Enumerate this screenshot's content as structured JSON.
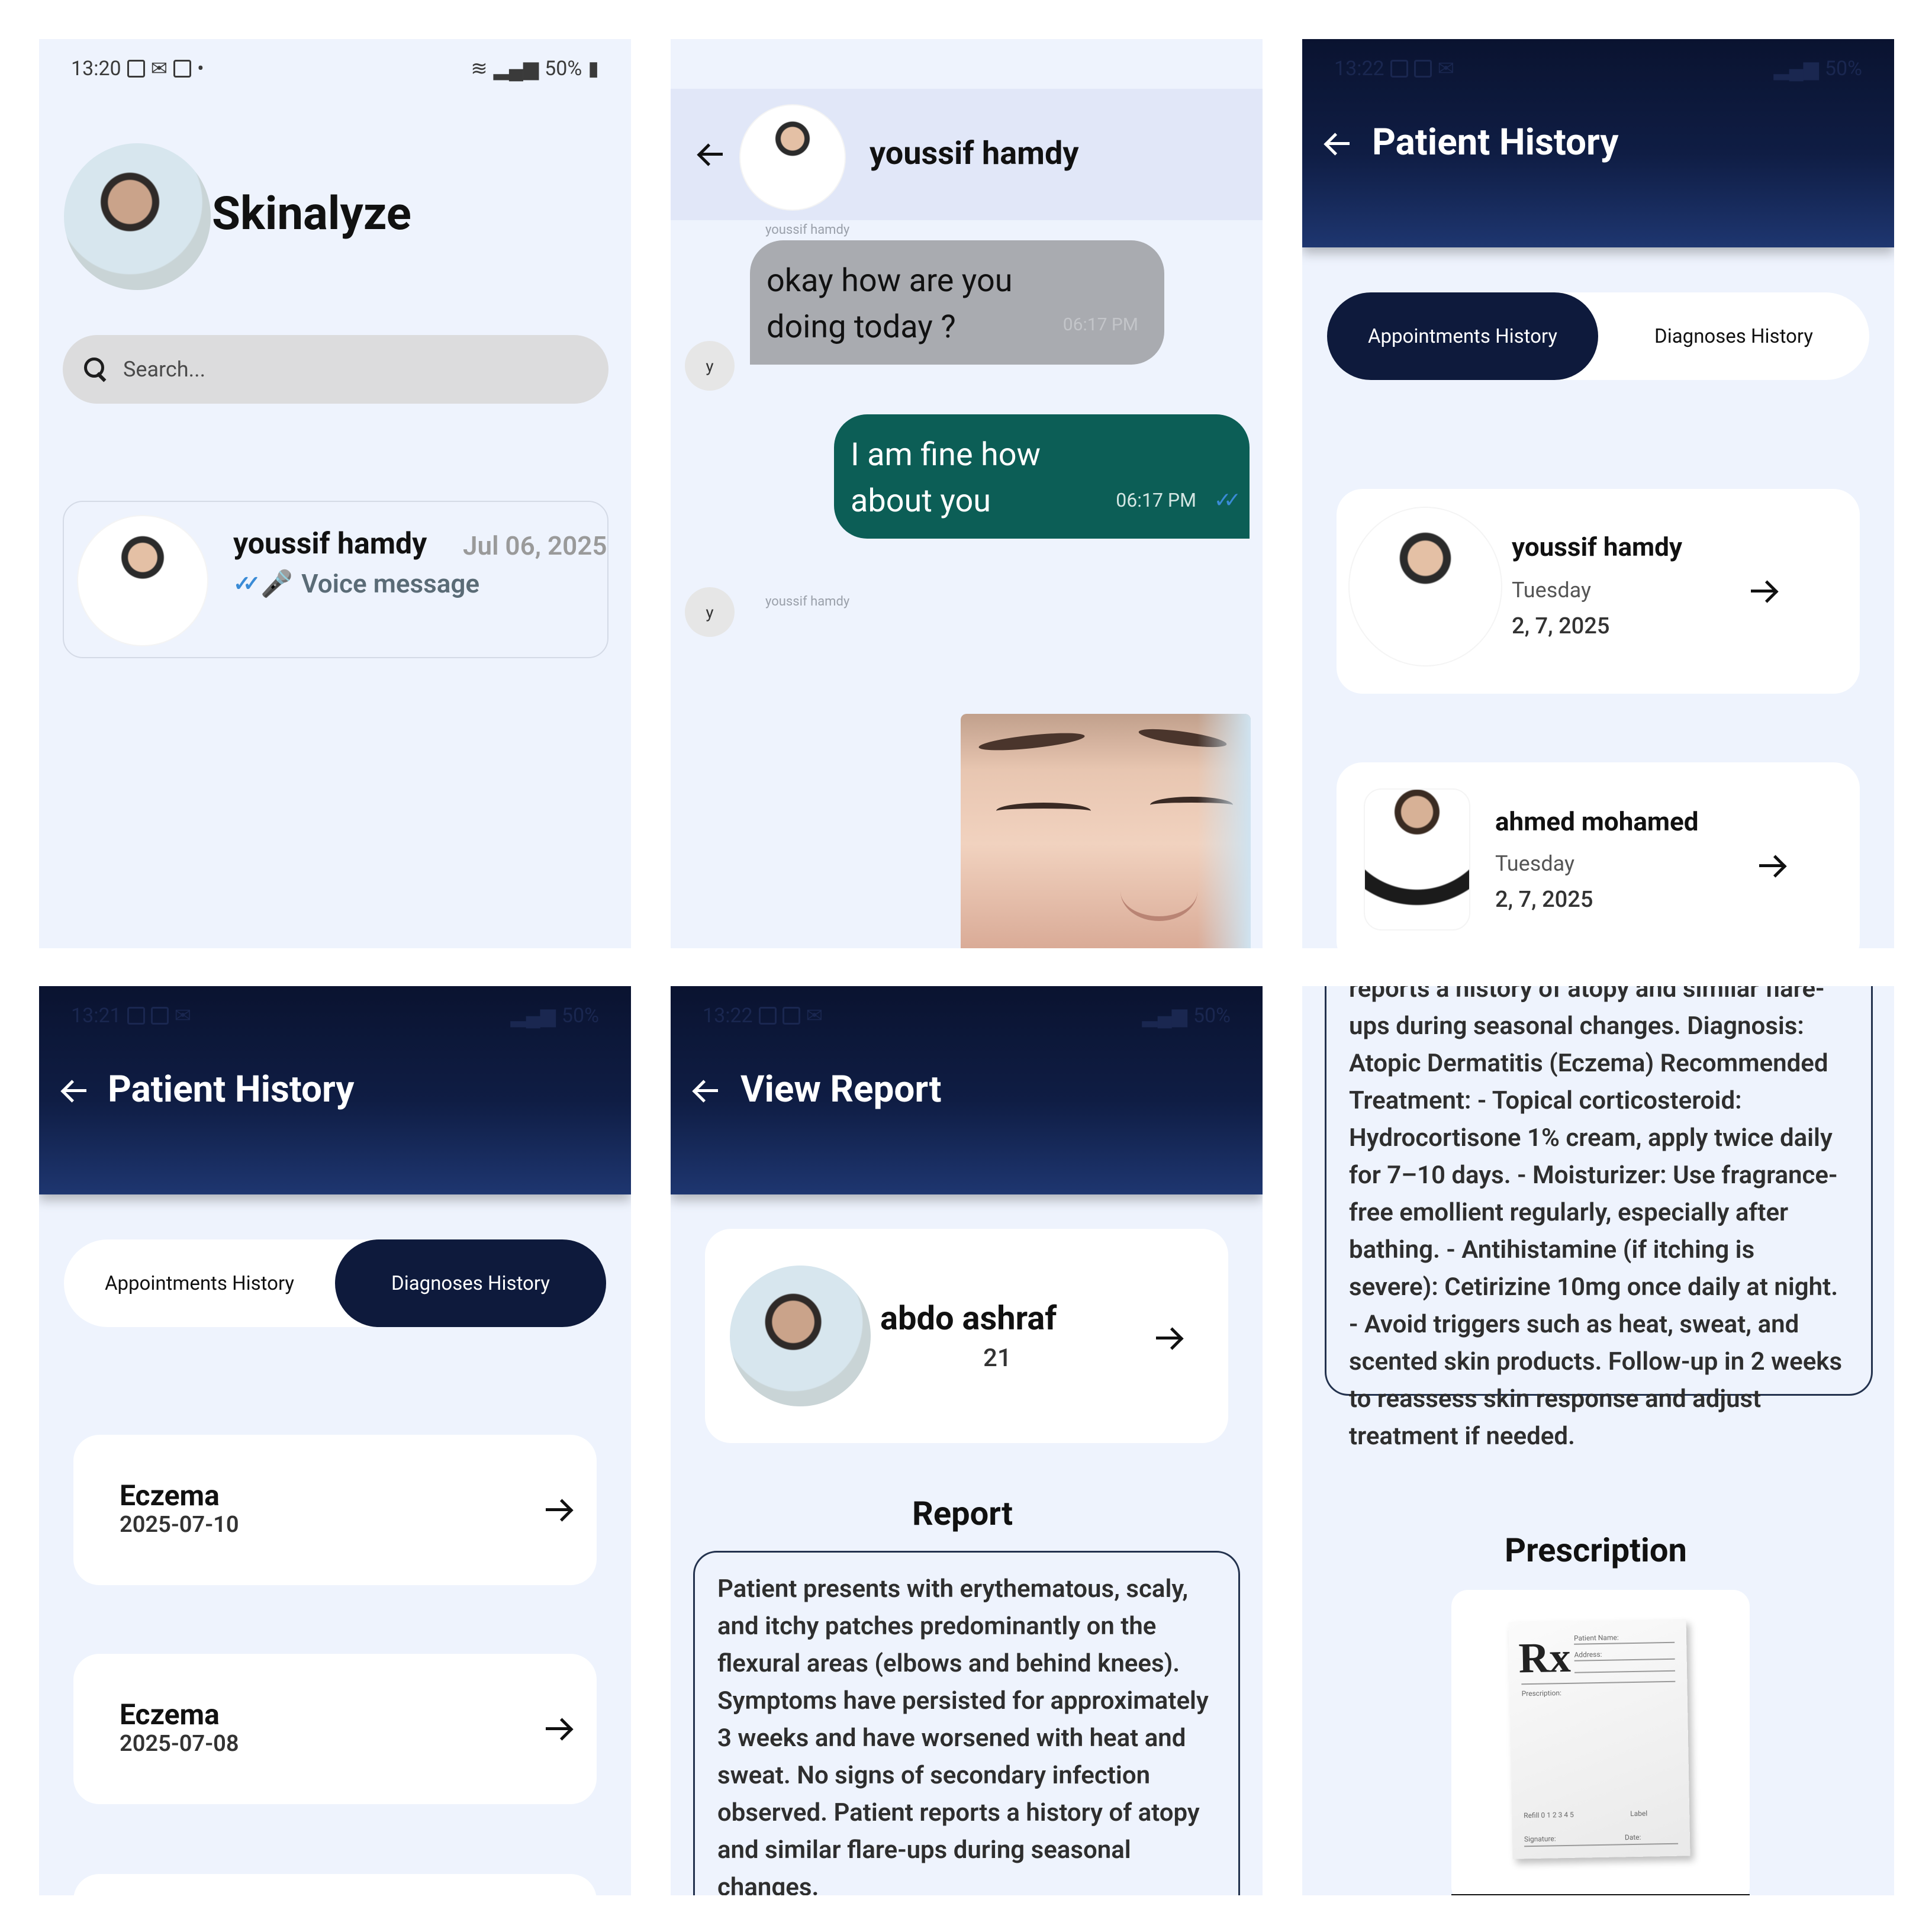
{
  "panel1": {
    "status": {
      "time": "13:20",
      "battery": "50%"
    },
    "app_title": "Skinalyze",
    "search_placeholder": "Search...",
    "chat": {
      "name": "youssif hamdy",
      "date": "Jul 06, 2025",
      "last_message": "Voice message"
    }
  },
  "panel2": {
    "contact_name": "youssif hamdy",
    "sender_label": "youssif hamdy",
    "sender_label_2": "youssif hamdy",
    "avatar_initial": "y",
    "incoming": {
      "text": "okay how are you\ndoing today ?",
      "time": "06:17 PM"
    },
    "outgoing": {
      "text": "I am fine how\nabout you",
      "time": "06:17 PM"
    }
  },
  "panel3": {
    "status": {
      "time": "13:22",
      "battery": "50%"
    },
    "title": "Patient History",
    "tabs": [
      "Appointments History",
      "Diagnoses History"
    ],
    "active_tab": "Appointments History",
    "appointments": [
      {
        "name": "youssif hamdy",
        "day": "Tuesday",
        "date": "2, 7, 2025"
      },
      {
        "name": "ahmed mohamed",
        "day": "Tuesday",
        "date": "2, 7, 2025"
      }
    ]
  },
  "panel4": {
    "status": {
      "time": "13:21",
      "battery": "50%"
    },
    "title": "Patient History",
    "tabs": [
      "Appointments History",
      "Diagnoses History"
    ],
    "active_tab": "Diagnoses History",
    "diagnoses": [
      {
        "name": "Eczema",
        "date": "2025-07-10"
      },
      {
        "name": "Eczema",
        "date": "2025-07-08"
      }
    ]
  },
  "panel5": {
    "status": {
      "time": "13:22",
      "battery": "50%"
    },
    "title": "View Report",
    "patient": {
      "name": "abdo ashraf",
      "age": "21"
    },
    "report_title": "Report",
    "report_text": "Patient presents with erythematous, scaly, and itchy patches predominantly on the flexural areas (elbows and behind knees). Symptoms have persisted for approximately 3 weeks and have worsened with heat and sweat. No signs of secondary infection observed. Patient reports a history of atopy and similar flare-ups during seasonal changes."
  },
  "panel6": {
    "report_text": "reports a history of atopy and similar flare-ups during seasonal changes. Diagnosis: Atopic Dermatitis (Eczema) Recommended Treatment: - Topical corticosteroid: Hydrocortisone 1% cream, apply twice daily for 7–10 days. - Moisturizer: Use fragrance-free emollient regularly, especially after bathing. - Antihistamine (if itching is severe): Cetirizine 10mg once daily at night. - Avoid triggers such as heat, sweat, and scented skin products. Follow-up in 2 weeks to reassess skin response and adjust treatment if needed.",
    "prescription_title": "Prescription",
    "rx_symbol": "Rx",
    "rx_fields": {
      "patient_name": "Patient Name:",
      "address": "Address:",
      "prescription": "Prescription:",
      "refill": "Refill 0 1 2 3 4 5",
      "label": "Label",
      "signature": "Signature:",
      "date": "Date:"
    }
  },
  "icons": [
    "wifi-icon",
    "signal-icon",
    "battery-icon",
    "linkedin-icon",
    "gmail-icon",
    "gallery-icon",
    "search-icon",
    "back-arrow-icon",
    "forward-arrow-icon",
    "double-check-icon",
    "microphone-icon"
  ],
  "colors": {
    "background": "#eef3fd",
    "header_dark": "#0e1a3c",
    "bubble_out": "#0c5e56",
    "bubble_in": "#a9abb0",
    "check_blue": "#3a8bd6"
  }
}
